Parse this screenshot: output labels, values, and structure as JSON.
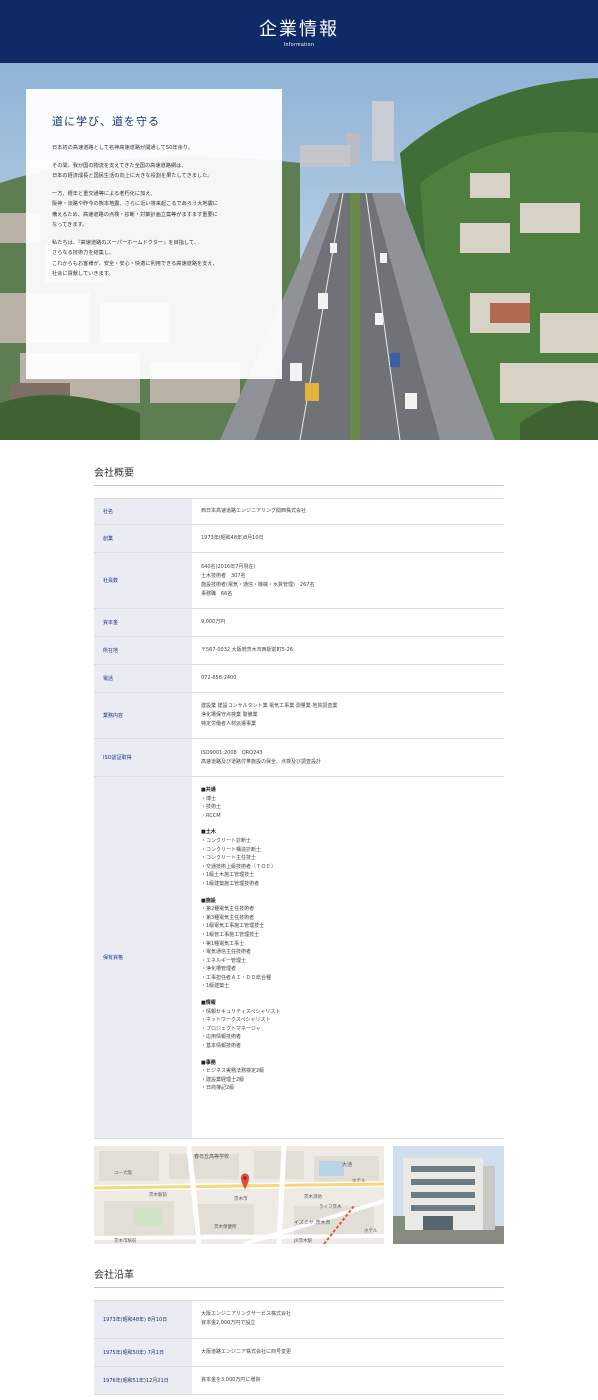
{
  "header": {
    "title": "企業情報",
    "subtitle": "Information"
  },
  "hero": {
    "heading": "道に学び、道を守る",
    "paragraphs": [
      [
        "日本初の高速道路として名神高速道路が開通して50年余り。"
      ],
      [
        "その間、我が国の物流を支えてきた全国の高速道路網は、",
        "日本の経済成長と国民生活の向上に大きな役割を果たしてきました。"
      ],
      [
        "一方、経年と重交通等による老朽化に加え、",
        "阪神・淡路や昨今の熊本地震、さらに近い将来起こるであろう大地震に",
        "備えるため、高速道路の点検・診断・対策計画立案等がますます重要に",
        "なってきます。"
      ],
      [
        "私たちは、『高速道路のスーパーホームドクター』を目指して、",
        "さらなる技術力を結集し、",
        "これからもお客様が、安全・安心・快適に利用できる高速道路を支え、",
        "社会に貢献していきます。"
      ]
    ]
  },
  "company": {
    "section_title": "会社概要",
    "rows": [
      {
        "label": "社名",
        "lines": [
          "西日本高速道路エンジニアリング関西株式会社"
        ]
      },
      {
        "label": "創業",
        "lines": [
          "1973年(昭和48年)8月10日"
        ]
      },
      {
        "label": "社員数",
        "lines": [
          "640名(2016年7月現在)",
          "土木技術者　307名",
          "施設技術者(電気・通信・機械・水質管理)　267名",
          "事務職　66名"
        ]
      },
      {
        "label": "資本金",
        "lines": [
          "9,000万円"
        ]
      },
      {
        "label": "所在地",
        "lines": [
          "〒567-0032 大阪府茨木市西駅前町5-26"
        ]
      },
      {
        "label": "電話",
        "lines": [
          "072-658-2400"
        ]
      },
      {
        "label": "業務内容",
        "lines": [
          "建設業 建設コンサルタント業 電気工事業 測量業 地質調査業",
          "浄化槽保守点検業 警備業",
          "特定労働者人材派遣事業"
        ]
      },
      {
        "label": "ISO認証取得",
        "lines": [
          "ISO9001:2008　QRQ243",
          "高速道路及び道路付帯施設の保全、点検及び調査設計"
        ]
      }
    ],
    "qualifications": {
      "label": "保有資格",
      "groups": [
        {
          "head": "■共通",
          "items": [
            "・博士",
            "・技術士",
            "・RCCM"
          ]
        },
        {
          "head": "■土木",
          "items": [
            "・コンクリート診断士",
            "・コンクリート構造診断士",
            "・コンクリート主任技士",
            "・交通技術上級技術者（ＴＯＥ）",
            "・1級土木施工管理技士",
            "・1級建築施工管理技術者"
          ]
        },
        {
          "head": "■施設",
          "items": [
            "・第2種電気主任技術者",
            "・第3種電気主任技術者",
            "・1級電気工事施工管理技士",
            "・1級管工事施工管理技士",
            "・第1種電気工事士",
            "・電気通信主任技術者",
            "・エネルギー管理士",
            "・浄化槽管理者",
            "・工事担任者ＡＩ・ＤＤ総合種",
            "・1級建築士"
          ]
        },
        {
          "head": "■情報",
          "items": [
            "・情報セキュリティスペシャリスト",
            "・ネットワークスペシャリスト",
            "・プロジェクトマネージャ",
            "・応用情報技術者",
            "・基本情報技術者"
          ]
        },
        {
          "head": "■事務",
          "items": [
            "・ビジネス実務法務検定2級",
            "・建設業経理士2級",
            "・日商簿記2級"
          ]
        }
      ]
    }
  },
  "map": {
    "labels": [
      "春日丘高等学校",
      "大池",
      "茨木消防",
      "ホテル",
      "ホテル",
      "茨木市",
      "茨木駅前",
      "イズミヤ 茨木市",
      "JR茨木駅",
      "茨木市駅前",
      "ユー大阪",
      "ライフ茨木",
      "茨木保健所"
    ]
  },
  "history": {
    "section_title": "会社沿革",
    "rows": [
      {
        "date": "1973年(昭和48年) 8月10日",
        "lines": [
          "大阪エンジニアリングサービス株式会社",
          "資本金2,000万円で設立"
        ]
      },
      {
        "date": "1975年(昭和50年) 7月1日",
        "lines": [
          "大阪道路エンジニア株式会社に商号変更"
        ]
      },
      {
        "date": "1976年(昭和51年)12月21日",
        "lines": [
          "資本金を3,000万円に増資"
        ]
      }
    ]
  }
}
